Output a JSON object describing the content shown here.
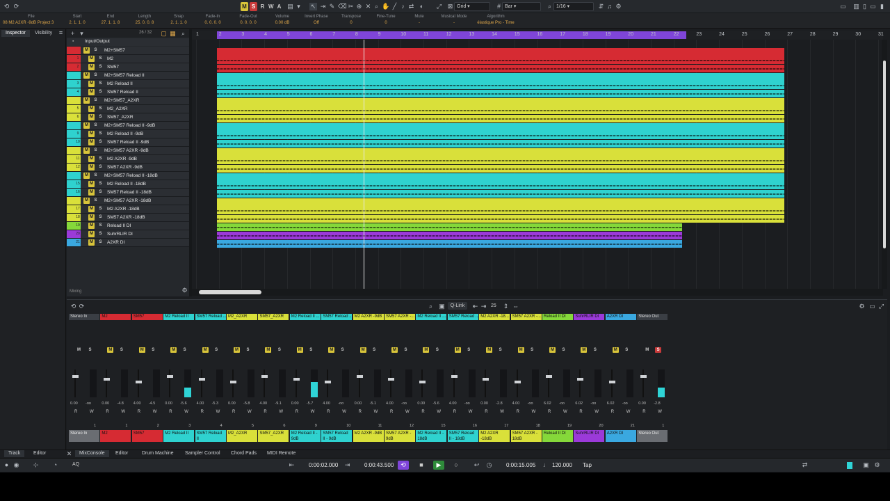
{
  "toolbar": {
    "mode_buttons": [
      "M",
      "S",
      "R",
      "W",
      "A"
    ],
    "snap_type": "Grid",
    "grid_type": "Bar",
    "quantize": "1/16"
  },
  "infoline": [
    {
      "label": "File",
      "value": "08 M2 A2XR -9dB Project 3"
    },
    {
      "label": "Start",
      "value": "2. 1. 1. 0"
    },
    {
      "label": "End",
      "value": "27. 1. 1. 8"
    },
    {
      "label": "Length",
      "value": "25. 0. 0. 8"
    },
    {
      "label": "Snap",
      "value": "2. 1. 1. 0"
    },
    {
      "label": "Fade-In",
      "value": "0. 0. 0. 0"
    },
    {
      "label": "Fade-Out",
      "value": "0. 0. 0. 0"
    },
    {
      "label": "Volume",
      "value": "0.00 dB"
    },
    {
      "label": "Invert Phase",
      "value": "Off"
    },
    {
      "label": "Transpose",
      "value": "0"
    },
    {
      "label": "Fine-Tune",
      "value": "0"
    },
    {
      "label": "Mute",
      "value": "-"
    },
    {
      "label": "Musical Mode",
      "value": "-"
    },
    {
      "label": "Algorithm",
      "value": "élastique Pro - Time"
    }
  ],
  "left_tabs": [
    "Inspector",
    "Visibility"
  ],
  "tracklist": {
    "count": "26 / 32",
    "folder": "Input/Output",
    "footer": "Mixing",
    "tracks": [
      {
        "name": "M2+SM57",
        "num": "",
        "color": "#d62b33",
        "folder": true
      },
      {
        "name": "M2",
        "num": "1",
        "color": "#d62b33"
      },
      {
        "name": "SM57",
        "num": "2",
        "color": "#d62b33"
      },
      {
        "name": "M2+SM57 Reload II",
        "num": "",
        "color": "#2fd2cf",
        "folder": true
      },
      {
        "name": "M2 Reload II",
        "num": "3",
        "color": "#2fd2cf"
      },
      {
        "name": "SM57 Reload II",
        "num": "4",
        "color": "#2fd2cf"
      },
      {
        "name": "M2+SM57_A2XR",
        "num": "",
        "color": "#d9e03a",
        "folder": true
      },
      {
        "name": "M2_A2XR",
        "num": "5",
        "color": "#d9e03a"
      },
      {
        "name": "SM57_A2XR",
        "num": "6",
        "color": "#d9e03a"
      },
      {
        "name": "M2+SM57 Reload II -9dB",
        "num": "",
        "color": "#2fd2cf",
        "folder": true
      },
      {
        "name": "M2 Reload II -9dB",
        "num": "9",
        "color": "#2fd2cf"
      },
      {
        "name": "SM57 Reload II -9dB",
        "num": "10",
        "color": "#2fd2cf"
      },
      {
        "name": "M2+SM57 A2XR -9dB",
        "num": "",
        "color": "#d9e03a",
        "folder": true
      },
      {
        "name": "M2 A2XR -9dB",
        "num": "11",
        "color": "#d9e03a"
      },
      {
        "name": "SM57 A2XR -9dB",
        "num": "12",
        "color": "#d9e03a"
      },
      {
        "name": "M2+SM57 Reload II -18dB",
        "num": "",
        "color": "#2fd2cf",
        "folder": true
      },
      {
        "name": "M2 Reload II -18dB",
        "num": "15",
        "color": "#2fd2cf"
      },
      {
        "name": "SM57 Reload II -18dB",
        "num": "16",
        "color": "#2fd2cf"
      },
      {
        "name": "M2+SM57 A2XR -18dB",
        "num": "",
        "color": "#d9e03a",
        "folder": true
      },
      {
        "name": "M2 A2XR -18dB",
        "num": "17",
        "color": "#d9e03a"
      },
      {
        "name": "SM57 A2XR -18dB",
        "num": "18",
        "color": "#d9e03a"
      },
      {
        "name": "Reload II DI",
        "num": "19",
        "color": "#85d83a"
      },
      {
        "name": "SuhrRLIR DI",
        "num": "20",
        "color": "#9b3ad9"
      },
      {
        "name": "A2XR DI",
        "num": "21",
        "color": "#3aa8e0"
      }
    ]
  },
  "ruler": [
    "1",
    "2",
    "3",
    "4",
    "5",
    "6",
    "7",
    "8",
    "9",
    "10",
    "11",
    "12",
    "13",
    "14",
    "15",
    "16",
    "17",
    "18",
    "19",
    "20",
    "21",
    "22",
    "23",
    "24",
    "25",
    "26",
    "27",
    "28",
    "29",
    "30",
    "31"
  ],
  "mixer": {
    "toolbar_qlink": "Q-Link",
    "toolbar_count": "25",
    "channels": [
      {
        "top": "Stereo In",
        "bottom": "Stereo In",
        "color": "#3a3e44",
        "vol": "0.00",
        "pan": "-oo",
        "num": "1"
      },
      {
        "top": "M2",
        "bottom": "M2",
        "color": "#d62b33",
        "vol": "0.00",
        "pan": "-4.8",
        "num": "1"
      },
      {
        "top": "SM57",
        "bottom": "SM57",
        "color": "#d62b33",
        "vol": "4.00",
        "pan": "-4.5",
        "num": "2"
      },
      {
        "top": "M2 Reload II",
        "bottom": "M2 Reload II",
        "color": "#2fd2cf",
        "vol": "0.00",
        "pan": "-5.6",
        "num": "3"
      },
      {
        "top": "SM57 Reload ...",
        "bottom": "SM57 Reload II",
        "color": "#2fd2cf",
        "vol": "4.00",
        "pan": "-5.3",
        "num": "4"
      },
      {
        "top": "M2_A2XR",
        "bottom": "M2_A2XR",
        "color": "#d9e03a",
        "vol": "0.00",
        "pan": "-5.8",
        "num": "5"
      },
      {
        "top": "SM57_A2XR",
        "bottom": "SM57_A2XR",
        "color": "#d9e03a",
        "vol": "4.00",
        "pan": "-9.1",
        "num": "6"
      },
      {
        "top": "M2 Reload II ...",
        "bottom": "M2 Reload II - 9dB",
        "color": "#2fd2cf",
        "vol": "0.00",
        "pan": "-5.7",
        "num": "9"
      },
      {
        "top": "SM57 Reload ...",
        "bottom": "SM57 Reload II - 9dB",
        "color": "#2fd2cf",
        "vol": "4.00",
        "pan": "-oo",
        "num": "10"
      },
      {
        "top": "M2 A2XR -9dB",
        "bottom": "M2 A2XR -9dB",
        "color": "#d9e03a",
        "vol": "0.00",
        "pan": "-5.1",
        "num": "11"
      },
      {
        "top": "SM57 A2XR -...",
        "bottom": "SM57 A2XR - 9dB",
        "color": "#d9e03a",
        "vol": "4.00",
        "pan": "-oo",
        "num": "12"
      },
      {
        "top": "M2 Reload II ...",
        "bottom": "M2 Reload II - 18dB",
        "color": "#2fd2cf",
        "vol": "0.00",
        "pan": "-5.6",
        "num": "15"
      },
      {
        "top": "SM57 Reload ...",
        "bottom": "SM57 Reload II - 18dB",
        "color": "#2fd2cf",
        "vol": "4.00",
        "pan": "-oo",
        "num": "16"
      },
      {
        "top": "M2 A2XR -18...",
        "bottom": "M2 A2XR -18dB",
        "color": "#d9e03a",
        "vol": "0.00",
        "pan": "-2.8",
        "num": "17"
      },
      {
        "top": "SM57 A2XR -...",
        "bottom": "SM57 A2XR - 18dB",
        "color": "#d9e03a",
        "vol": "4.00",
        "pan": "-oo",
        "num": "18"
      },
      {
        "top": "Reload II DI",
        "bottom": "Reload II DI",
        "color": "#85d83a",
        "vol": "6.02",
        "pan": "-oo",
        "num": "19"
      },
      {
        "top": "SuhrRLIR DI",
        "bottom": "SuhrRLIR DI",
        "color": "#9b3ad9",
        "vol": "6.02",
        "pan": "-oo",
        "num": "20"
      },
      {
        "top": "A2XR DI",
        "bottom": "A2XR DI",
        "color": "#3aa8e0",
        "vol": "6.02",
        "pan": "-oo",
        "num": "21"
      },
      {
        "top": "Stereo Out",
        "bottom": "Stereo Out",
        "color": "#3a3e44",
        "vol": "0.00",
        "pan": "-2.8",
        "num": "1"
      }
    ]
  },
  "bottom_tabs": {
    "left": [
      "Track",
      "Editor"
    ],
    "right": [
      "MixConsole",
      "Editor",
      "Drum Machine",
      "Sampler Control",
      "Chord Pads",
      "MIDI Remote"
    ]
  },
  "transport": {
    "left_locator": "0:00:02.000",
    "right_locator": "0:00:43.500",
    "position": "0:00:15.005",
    "tempo": "120.000",
    "tap": "Tap"
  },
  "colors": {
    "red": "#d62b33",
    "cyan": "#2fd2cf",
    "yellow": "#d9e03a",
    "green": "#85d83a",
    "purple": "#9b3ad9",
    "blue": "#3aa8e0",
    "cycle": "#7f45d9"
  }
}
